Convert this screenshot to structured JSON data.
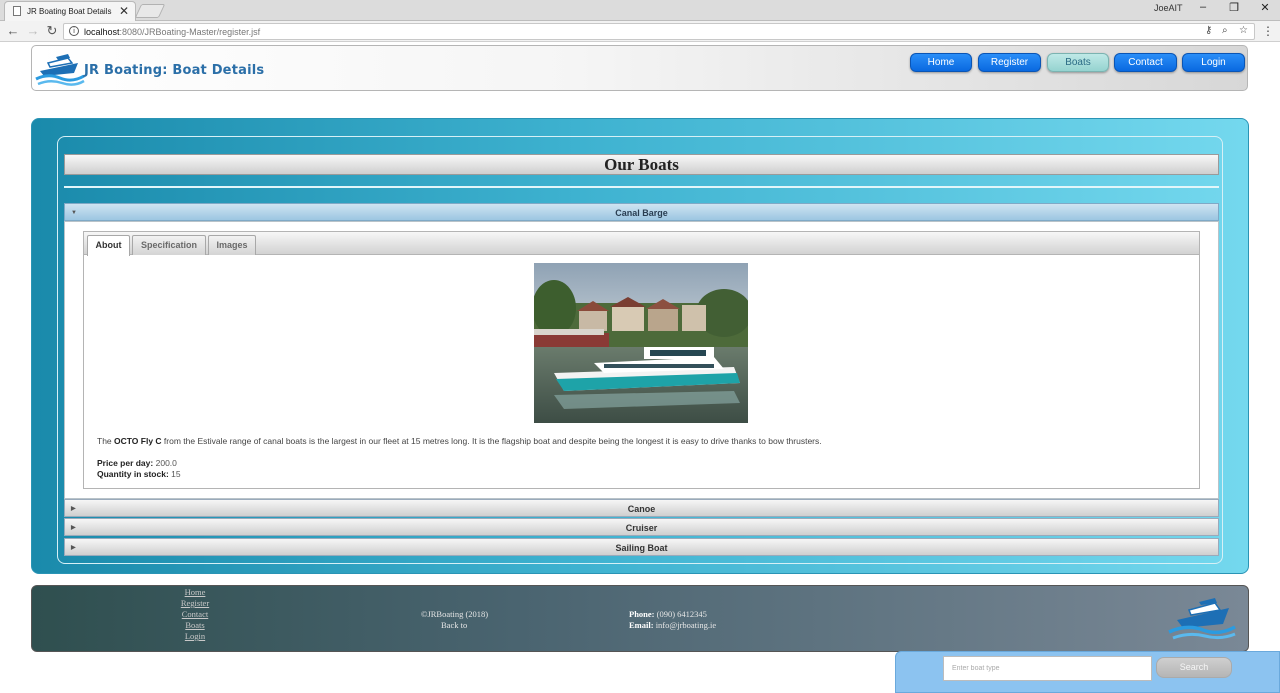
{
  "browser": {
    "tab_title": "JR Boating Boat Details",
    "tab_close": "✕",
    "window_user": "JoeAIT",
    "address_host": "localhost",
    "address_path": ":8080/JRBoating-Master/register.jsf"
  },
  "header": {
    "site_title": "JR Boating: Boat Details",
    "nav": [
      "Home",
      "Register",
      "Boats",
      "Contact",
      "Login"
    ],
    "active_nav": "Boats"
  },
  "main": {
    "heading": "Our Boats",
    "accordion": [
      {
        "label": "Canal Barge",
        "expanded": true
      },
      {
        "label": "Canoe",
        "expanded": false
      },
      {
        "label": "Cruiser",
        "expanded": false
      },
      {
        "label": "Sailing Boat",
        "expanded": false
      }
    ],
    "tabs": [
      "About",
      "Specification",
      "Images"
    ],
    "active_tab": "About",
    "description": {
      "prefix": "The ",
      "boat_name": "OCTO Fly C",
      "suffix": " from the Estivale range of canal boats is the largest in our fleet at 15 metres long. It is the flagship boat and despite being the longest it is easy to drive thanks to bow thrusters."
    },
    "price_label": "Price per day:",
    "price_value": "200.0",
    "stock_label": "Quantity in stock:",
    "stock_value": "15"
  },
  "footer": {
    "links": [
      "Home",
      "Register",
      "Contact",
      "Boats",
      "Login"
    ],
    "copyright": "©JRBoating (2018)",
    "back_to": "Back to",
    "phone_label": "Phone:",
    "phone_value": "(090) 6412345",
    "email_label": "Email:",
    "email_value": "info@jrboating.ie"
  },
  "search": {
    "placeholder": "Enter boat type",
    "button_label": "Search"
  },
  "colors": {
    "nav_blue": "#0f75ee",
    "nav_active": "#a9dedb",
    "panel_teal": "#3eb2d0",
    "footer_dark": "#2f4f4f",
    "search_bg": "#8cc3f0"
  }
}
